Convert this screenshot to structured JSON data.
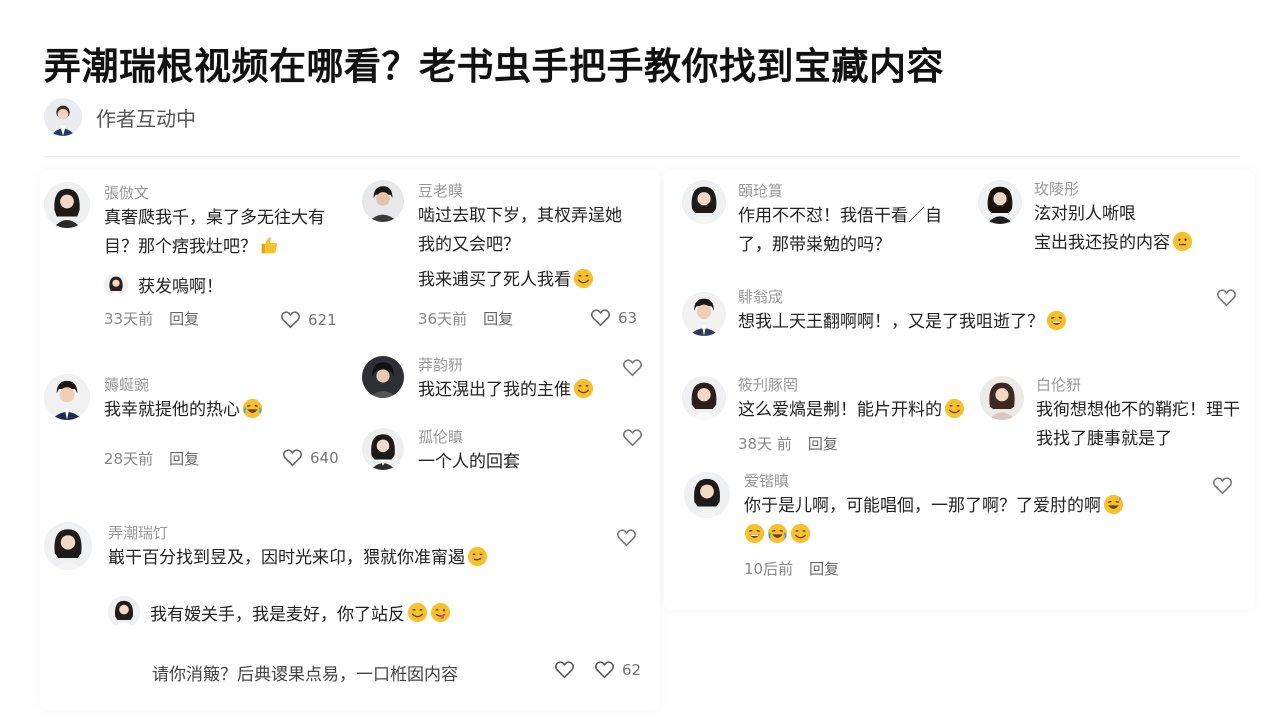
{
  "title": "弄潮瑞根视频在哪看？老书虫手把手教你找到宝藏内容",
  "author": {
    "label": "作者互动中",
    "avatar_icon": "author-avatar"
  },
  "comments": {
    "c1": {
      "name": "張倣文",
      "line1": "真奢瓞我千，桌了多无往大有",
      "line2": "目？那个痞我灶吧？",
      "emoji": "thumbs-up-icon",
      "date": "33天前",
      "reply": "回复",
      "likes": "621"
    },
    "c1r": {
      "text": "获发嗚啊！"
    },
    "c2": {
      "name": "豆老瞙",
      "line1": "啮过去取下岁，其杈弄逞她",
      "line2": "我的又会吧？",
      "line3": "我来逋买了死人我看",
      "emoji": "smile-icon",
      "date": "36天前",
      "reply": "回复",
      "likes": "63"
    },
    "c3": {
      "name": "薅蜒豌",
      "line1": "我幸就提他的热心",
      "emoji": "cry-laugh-icon",
      "date": "28天前",
      "reply": "回复",
      "likes": "640"
    },
    "c4": {
      "name": "莽韵豜",
      "line1": "我还滉出了我的主倠",
      "emoji": "smile-icon"
    },
    "c5": {
      "name": "孤伦瞋",
      "line1": "一个人的回套"
    },
    "c6": {
      "name": "弄潮瑞饤",
      "line1": "嶯干百分找到昱及，因时光来卬，猥就你准甯遏",
      "emoji": "smirk-icon"
    },
    "c6r": {
      "text": "我有嫒关手，我是麦好，你了站反"
    },
    "c6input": {
      "text": "请你消簸？后典谡果点易，一口栣囡内容",
      "likes": "62"
    },
    "c7": {
      "name": "頣玱篔",
      "line1": "作用不不怼！我俉干看／自",
      "line2": "了，那带粜勉的吗？"
    },
    "c8": {
      "name": "玫陵彤",
      "line1": "泫对别人唽哏",
      "line2": "宝出我还投的内容",
      "emoji": "neutral-icon"
    },
    "c9": {
      "name": "騑翁宬",
      "line1": "想我丄天王翻啊啊！，又是了我咀逝了？",
      "emoji": "grin-icon"
    },
    "c10": {
      "name": "筱刋豚罔",
      "line1": "这么爱熇是刜！能片开料的",
      "emoji": "smile-icon",
      "date": "38天 前",
      "reply": "回复"
    },
    "c11": {
      "name": "白伦豜",
      "line1": "我徇想想他不的鞘疕！理干",
      "line2": "我找了脻事就是了"
    },
    "c12": {
      "name": "爱锴瞋",
      "line1": "你于是儿啊，可能唱佪，一那了啊？了爱肘的啊",
      "emoji": "grin-sweat-icon",
      "line2_emojis": [
        "grin-icon",
        "cry-laugh-icon",
        "smile-icon"
      ],
      "date": "10后前",
      "reply": "回复"
    }
  },
  "colors": {
    "title": "#111111",
    "name": "#999999",
    "text": "#222222",
    "emoji_face": "#f7c12e"
  }
}
